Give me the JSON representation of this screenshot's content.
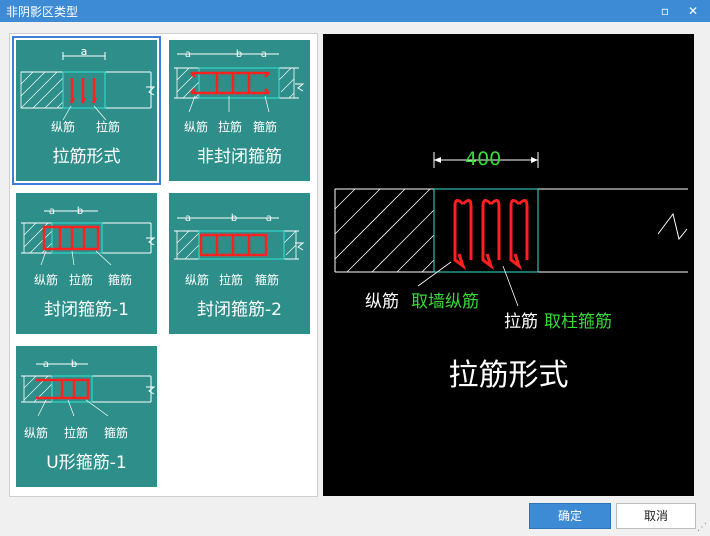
{
  "window": {
    "title": "非阴影区类型",
    "restore_icon": "restore-icon",
    "close_icon": "close-icon",
    "close_glyph": "✕",
    "restore_glyph": "▫"
  },
  "tiles": [
    {
      "label": "拉筋形式",
      "dim": "a",
      "parts": [
        "纵筋",
        "拉筋"
      ],
      "selected": true
    },
    {
      "label": "非封闭箍筋",
      "dim_a": "a",
      "dim_b": "b",
      "dim_a2": "a",
      "parts": [
        "纵筋",
        "拉筋",
        "箍筋"
      ]
    },
    {
      "label": "封闭箍筋-1",
      "dim_a": "a",
      "dim_b": "b",
      "parts": [
        "纵筋",
        "拉筋",
        "箍筋"
      ]
    },
    {
      "label": "封闭箍筋-2",
      "dim_a": "a",
      "dim_b": "b",
      "dim_a2": "a",
      "parts": [
        "纵筋",
        "拉筋",
        "箍筋"
      ]
    },
    {
      "label": "U形箍筋-1",
      "dim_a": "a",
      "dim_b": "b",
      "parts": [
        "纵筋",
        "拉筋",
        "箍筋"
      ]
    }
  ],
  "preview": {
    "dimension": "400",
    "label1_white": "纵筋",
    "label1_green": "取墙纵筋",
    "label2_white": "拉筋",
    "label2_green": "取柱箍筋",
    "title": "拉筋形式"
  },
  "buttons": {
    "ok": "确定",
    "cancel": "取消"
  }
}
